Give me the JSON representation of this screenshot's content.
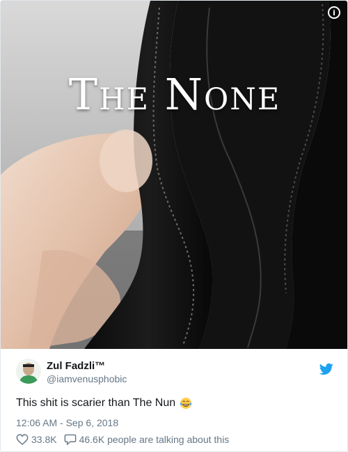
{
  "image": {
    "overlay_title": "The None",
    "info_icon": "info-icon"
  },
  "tweet": {
    "author_name": "Zul Fadzli™",
    "author_handle": "@iamvenusphobic",
    "text": "This shit is scarier than The Nun",
    "emoji": "face-with-tears-of-joy",
    "timestamp": "12:06 AM - Sep 6, 2018",
    "likes": "33.8K",
    "replies_label": "46.6K people are talking about this"
  },
  "colors": {
    "twitter_blue": "#1da1f2",
    "muted": "#657786",
    "text": "#14171a"
  }
}
